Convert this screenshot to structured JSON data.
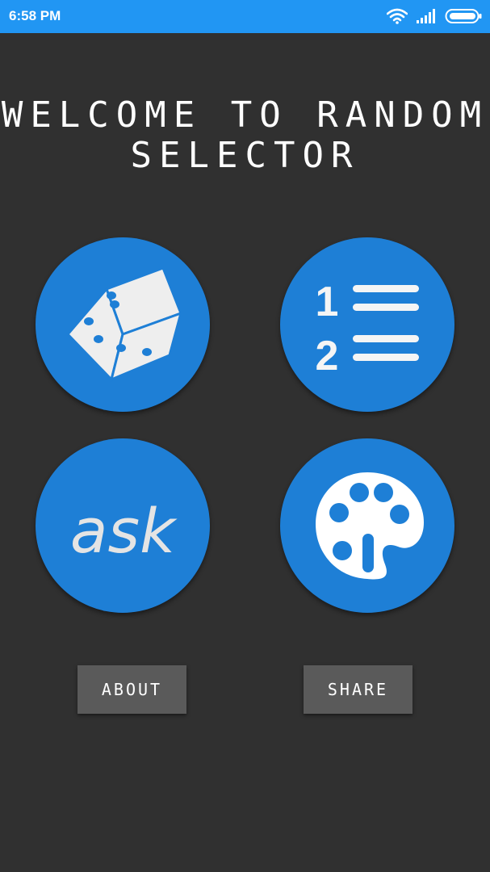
{
  "status_bar": {
    "time": "6:58 PM",
    "icons": [
      "wifi-icon",
      "signal-icon",
      "battery-icon"
    ],
    "color": "#2196f3"
  },
  "main": {
    "title_line1": "WELCOME TO RANDOM",
    "title_line2": "SELECTOR",
    "background_color": "#303030"
  },
  "menu_buttons": [
    {
      "icon": "dice-icon"
    },
    {
      "icon": "numbered-list-icon"
    },
    {
      "icon": "ask-icon",
      "label": "ask"
    },
    {
      "icon": "palette-icon"
    }
  ],
  "buttons": {
    "about_label": "ABOUT",
    "share_label": "SHARE"
  },
  "colors": {
    "accent": "#1e7fd6",
    "button_bg": "#5a5a5a"
  }
}
